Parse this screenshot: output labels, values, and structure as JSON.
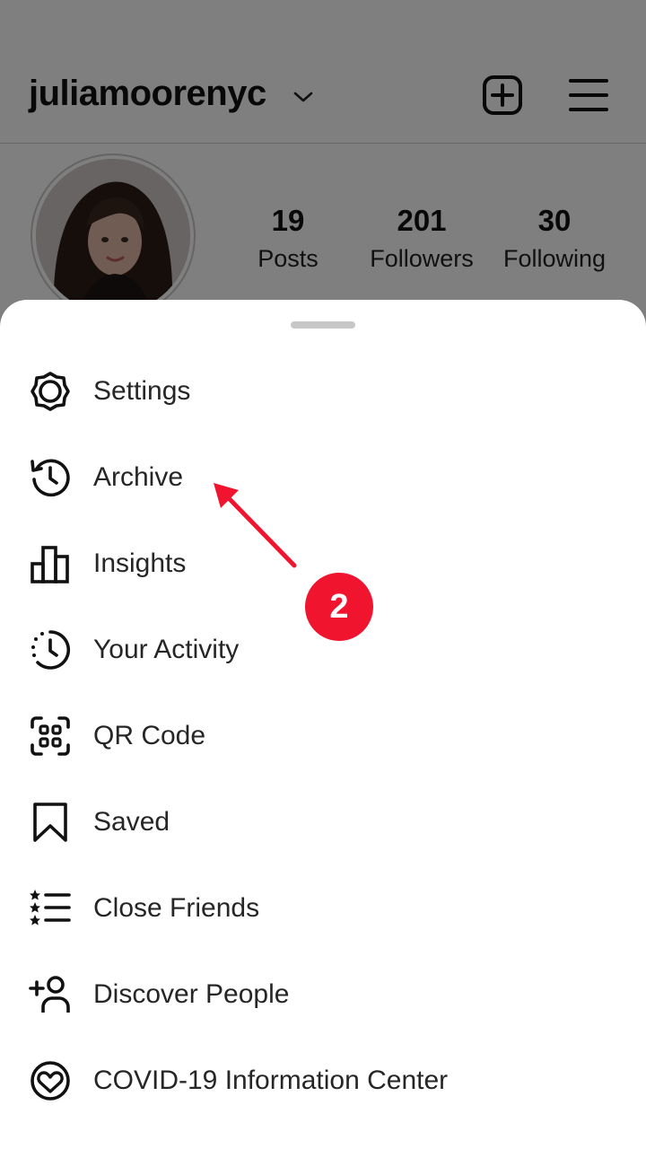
{
  "header": {
    "username": "juliamoorenyc"
  },
  "profile": {
    "stats": [
      {
        "value": "19",
        "label": "Posts"
      },
      {
        "value": "201",
        "label": "Followers"
      },
      {
        "value": "30",
        "label": "Following"
      }
    ]
  },
  "menu": {
    "items": [
      {
        "label": "Settings",
        "icon": "settings-icon"
      },
      {
        "label": "Archive",
        "icon": "archive-icon"
      },
      {
        "label": "Insights",
        "icon": "insights-icon"
      },
      {
        "label": "Your Activity",
        "icon": "activity-icon"
      },
      {
        "label": "QR Code",
        "icon": "qr-code-icon"
      },
      {
        "label": "Saved",
        "icon": "bookmark-icon"
      },
      {
        "label": "Close Friends",
        "icon": "close-friends-icon"
      },
      {
        "label": "Discover People",
        "icon": "add-person-icon"
      },
      {
        "label": "COVID-19 Information Center",
        "icon": "heart-globe-icon"
      }
    ]
  },
  "annotation": {
    "step": "2",
    "color": "#f0142f"
  }
}
